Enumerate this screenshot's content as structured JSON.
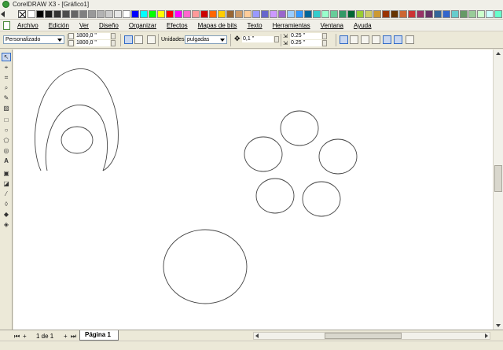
{
  "window": {
    "title": "CorelDRAW X3 - [Gráfico1]"
  },
  "palette": {
    "colors": [
      "#ffffff",
      "#000000",
      "#1a1a1a",
      "#333333",
      "#4d4d4d",
      "#666666",
      "#808080",
      "#999999",
      "#b3b3b3",
      "#cccccc",
      "#e6e6e6",
      "#ffffff",
      "#0000ff",
      "#00ffff",
      "#00ff00",
      "#ffff00",
      "#ff0000",
      "#ff00ff",
      "#ff66cc",
      "#ff9999",
      "#cc0000",
      "#ff6600",
      "#ffcc00",
      "#996633",
      "#cc9966",
      "#ffcc99",
      "#9999ff",
      "#6666cc",
      "#cc99ff",
      "#9966cc",
      "#99ccff",
      "#3399ff",
      "#006699",
      "#33cccc",
      "#99ffcc",
      "#66cc99",
      "#339966",
      "#006633",
      "#99cc33",
      "#cccc66",
      "#cc9933",
      "#993300",
      "#663300",
      "#cc6633",
      "#cc3333",
      "#993366",
      "#663366",
      "#336699",
      "#3366cc",
      "#66cccc",
      "#669966",
      "#99cc99",
      "#ccffcc",
      "#ccffff",
      "#66ffcc"
    ]
  },
  "menu": {
    "items": [
      "Archivo",
      "Edición",
      "Ver",
      "Diseño",
      "Organizar",
      "Efectos",
      "Mapas de bits",
      "Texto",
      "Herramientas",
      "Ventana",
      "Ayuda"
    ]
  },
  "properties": {
    "page_size_preset": "Personalizado",
    "width": "1800,0 \"",
    "height": "1800,0 \"",
    "units_label": "Unidades:",
    "units_value": "pulgadas",
    "nudge": "0,1 \"",
    "duplicate_x": "0.25 \"",
    "duplicate_y": "0.25 \""
  },
  "toolbox": {
    "tools": [
      "pick-tool-icon",
      "shape-tool-icon",
      "crop-tool-icon",
      "zoom-tool-icon",
      "freehand-tool-icon",
      "smart-fill-tool-icon",
      "rectangle-tool-icon",
      "ellipse-tool-icon",
      "polygon-tool-icon",
      "spiral-tool-icon",
      "text-tool-icon",
      "interactive-blend-tool-icon",
      "transparency-tool-icon",
      "eyedropper-tool-icon",
      "outline-tool-icon",
      "fill-tool-icon",
      "interactive-fill-tool-icon"
    ]
  },
  "pagebar": {
    "page_count": "1 de 1",
    "page_tab": "Página 1"
  }
}
